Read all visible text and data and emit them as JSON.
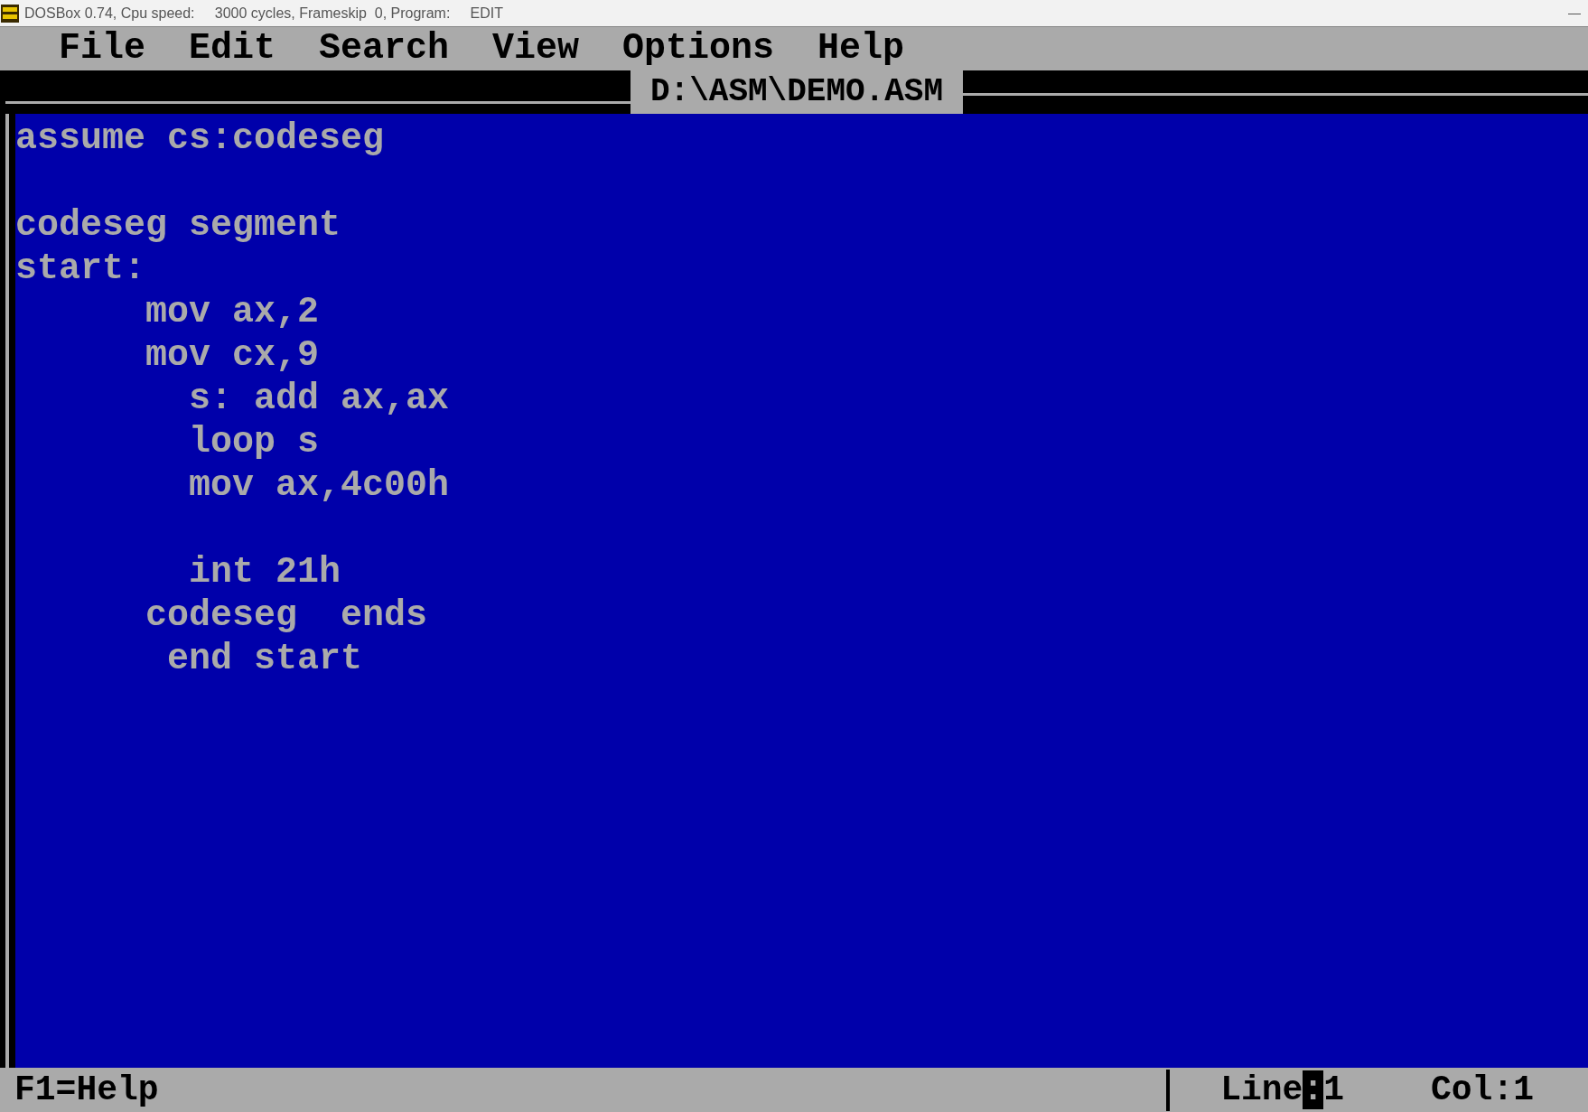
{
  "window": {
    "title": "DOSBox 0.74, Cpu speed:     3000 cycles, Frameskip  0, Program:     EDIT",
    "controls": [
      "—"
    ]
  },
  "menu": [
    "File",
    "Edit",
    "Search",
    "View",
    "Options",
    "Help"
  ],
  "editor": {
    "file_title": "D:\\ASM\\DEMO.ASM",
    "lines": [
      {
        "kind": "code",
        "text": "assume cs:codeseg"
      },
      {
        "kind": "blank"
      },
      {
        "kind": "code",
        "text": "codeseg segment"
      },
      {
        "kind": "code",
        "text": "start:"
      },
      {
        "kind": "code",
        "text": "      mov ax,2"
      },
      {
        "kind": "code",
        "text": "      mov cx,9"
      },
      {
        "kind": "code",
        "text": "        s: add ax,ax"
      },
      {
        "kind": "code",
        "text": "        loop s"
      },
      {
        "kind": "code",
        "text": "        mov ax,4c00h"
      },
      {
        "kind": "blank"
      },
      {
        "kind": "code",
        "text": "        int 21h"
      },
      {
        "kind": "code",
        "text": "      codeseg  ends"
      },
      {
        "kind": "code",
        "text": "       end start"
      }
    ]
  },
  "status_bar": {
    "help": "F1=Help",
    "line": {
      "label": "Line",
      "separator": ":",
      "value": "1"
    },
    "column": "Col:1"
  }
}
